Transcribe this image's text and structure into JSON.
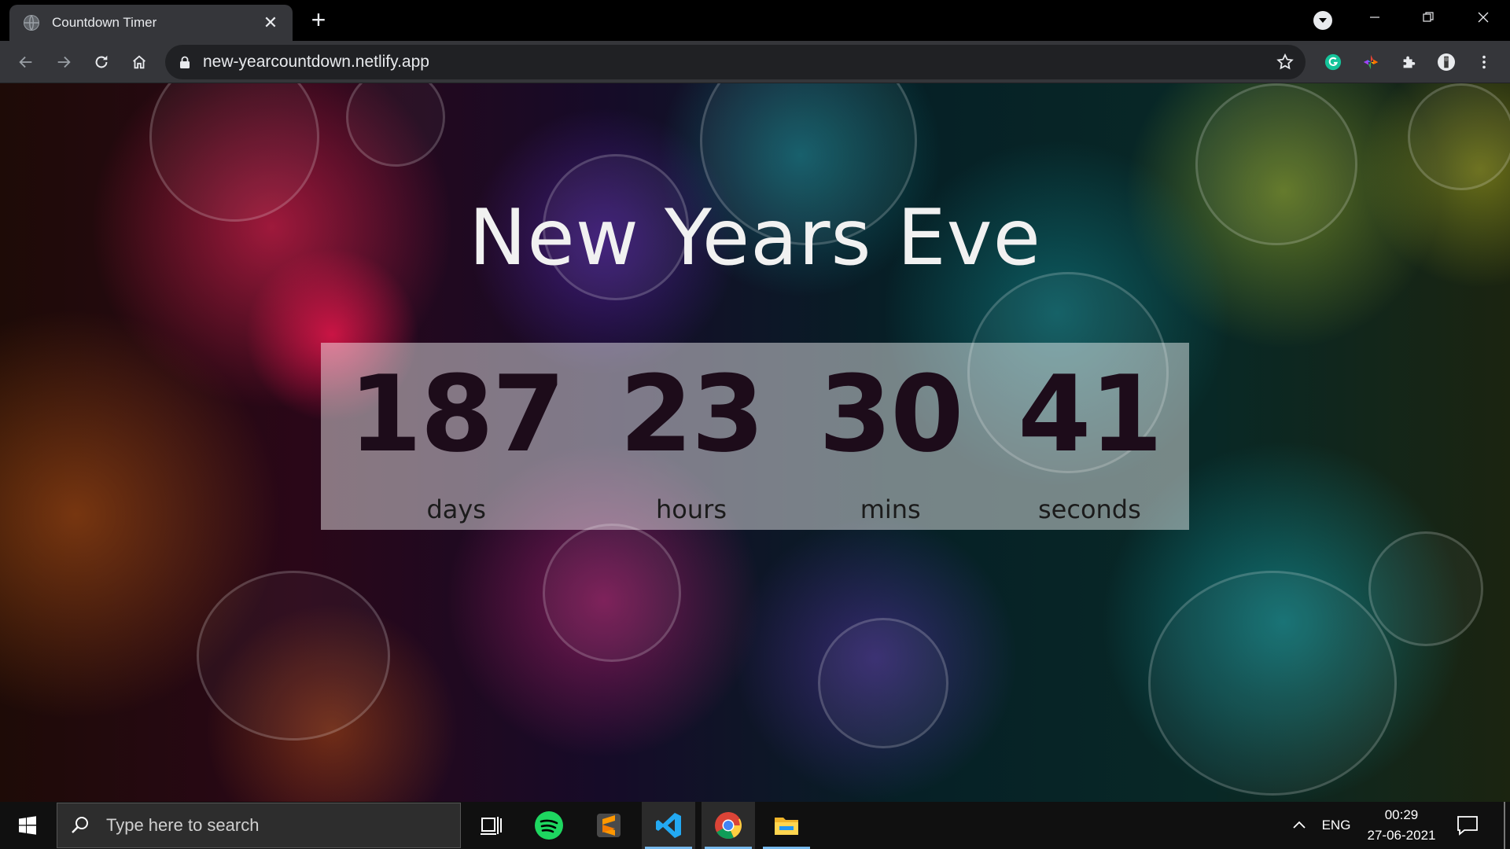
{
  "browser": {
    "tab": {
      "title": "Countdown Timer",
      "close_icon": "close-icon",
      "favicon_icon": "globe-icon"
    },
    "new_tab_label": "+",
    "window_controls": [
      "minimize-icon",
      "restore-icon",
      "close-icon"
    ],
    "toolbar": {
      "buttons": [
        "back-icon",
        "forward-icon",
        "reload-icon",
        "home-icon"
      ],
      "url": "new-yearcountdown.netlify.app",
      "extensions": [
        "grammarly-icon",
        "color-picker-icon",
        "puzzle-icon",
        "profile-avatar"
      ]
    }
  },
  "page": {
    "title": "New Years Eve",
    "countdown": [
      {
        "value": "187",
        "label": "days"
      },
      {
        "value": "23",
        "label": "hours"
      },
      {
        "value": "30",
        "label": "mins"
      },
      {
        "value": "41",
        "label": "seconds"
      }
    ]
  },
  "taskbar": {
    "search_placeholder": "Type here to search",
    "apps": [
      "task-view-icon",
      "spotify-icon",
      "sublime-text-icon",
      "vscode-icon",
      "chrome-icon",
      "file-explorer-icon"
    ],
    "active_app": "chrome-icon",
    "tray": {
      "language": "ENG",
      "time": "00:29",
      "date": "27-06-2021"
    }
  },
  "colors": {
    "tab_bg": "#35363a",
    "chrome_bg": "#000000",
    "omnibox_bg": "#202124",
    "countdown_panel": "rgba(255,255,255,0.45)",
    "countdown_text": "#1d0c1a",
    "taskbar_bg": "#101010",
    "taskbar_accent": "#76b9ed"
  }
}
